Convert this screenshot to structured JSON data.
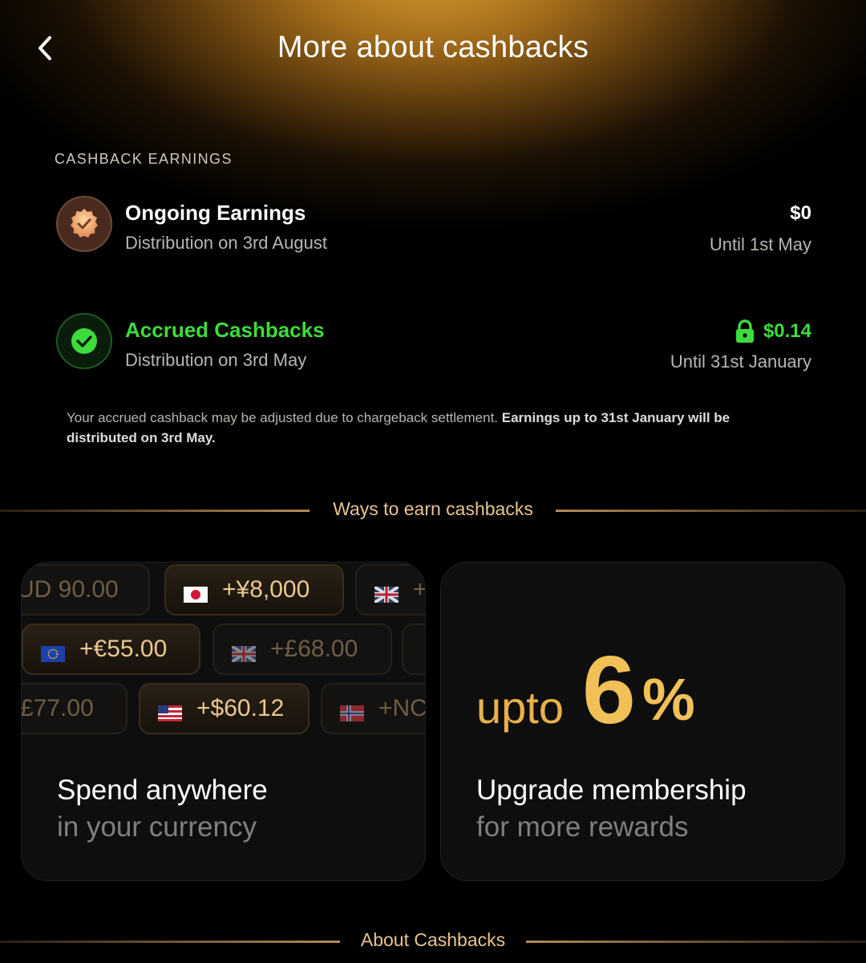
{
  "header": {
    "title": "More about cashbacks"
  },
  "earnings": {
    "section_label": "CASHBACK EARNINGS",
    "ongoing": {
      "title": "Ongoing Earnings",
      "subtitle": "Distribution on 3rd August",
      "amount": "$0",
      "until": "Until 1st May",
      "icon": "badge-check-icon"
    },
    "accrued": {
      "title": "Accrued Cashbacks",
      "subtitle": "Distribution on 3rd May",
      "amount": "$0.14",
      "until": "Until 31st January",
      "icon": "check-circle-icon",
      "lock_icon": "lock-icon",
      "accent_color": "#3ddc3d"
    },
    "note_plain": "Your accrued cashback may be adjusted due to chargeback settlement. ",
    "note_bold": "Earnings up to 31st January will be distributed on 3rd May."
  },
  "ways_divider": "Ways to earn cashbacks",
  "cards": {
    "spend": {
      "title": "Spend anywhere",
      "subtitle": "in your currency",
      "chips": [
        {
          "text": "UD 90.00",
          "flag": "none"
        },
        {
          "text": "+¥8,000",
          "flag": "japan"
        },
        {
          "text": "+",
          "flag": "uk"
        },
        {
          "text": "+€55.00",
          "flag": "eu"
        },
        {
          "text": "+£68.00",
          "flag": "uk"
        },
        {
          "text": "£77.00",
          "flag": "none"
        },
        {
          "text": "+$60.12",
          "flag": "usa"
        },
        {
          "text": "+NC",
          "flag": "norway"
        }
      ]
    },
    "upgrade": {
      "upto": "upto",
      "number": "6",
      "percent": "%",
      "title": "Upgrade membership",
      "subtitle": "for more rewards"
    }
  },
  "about_divider": "About Cashbacks"
}
